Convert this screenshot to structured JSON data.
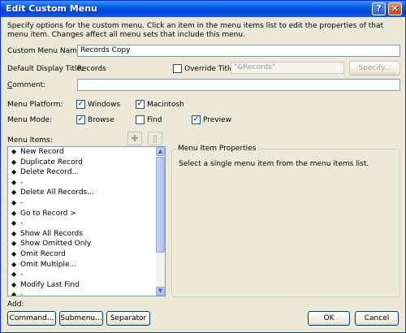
{
  "window": {
    "title": "Edit Custom Menu"
  },
  "description": "Specify options for the custom menu. Click an item in the menu items list to edit the properties of that menu item. Changes affect all menu sets that include this menu.",
  "custom_menu_name": {
    "label": "Custom Menu Name:",
    "value": "Records Copy"
  },
  "default_display_title": {
    "label": "Default Display Title:",
    "value": "Records"
  },
  "override_title": {
    "label": "Override Title:",
    "checked": false,
    "value": "\"&Records\"",
    "specify_label": "Specify..."
  },
  "comment": {
    "label": "Comment:",
    "value": ""
  },
  "menu_platform": {
    "label": "Menu Platform:",
    "options": [
      {
        "label": "Windows",
        "checked": true
      },
      {
        "label": "Macintosh",
        "checked": true
      }
    ]
  },
  "menu_mode": {
    "label": "Menu Mode:",
    "options": [
      {
        "label": "Browse",
        "checked": true
      },
      {
        "label": "Find",
        "checked": false
      },
      {
        "label": "Preview",
        "checked": true
      }
    ]
  },
  "menu_items": {
    "label": "Menu Items:",
    "items": [
      "New Record",
      "Duplicate Record",
      "Delete Record...",
      "-",
      "Delete All Records...",
      "-",
      "Go to Record >",
      "-",
      "Show All Records",
      "Show Omitted Only",
      "Omit Record",
      "Omit Multiple...",
      "-",
      "Modify Last Find",
      "-"
    ]
  },
  "menu_item_properties": {
    "title": "Menu Item Properties",
    "message": "Select a single menu item from the menu items list."
  },
  "add": {
    "label": "Add:",
    "command_label": "Command...",
    "submenu_label": "Submenu...",
    "separator_label": "Separator"
  },
  "ok_label": "OK",
  "cancel_label": "Cancel",
  "colors": {
    "titlebar": "#0a5fe8",
    "face": "#ece9d8",
    "scroll": "#a9c0f0"
  }
}
